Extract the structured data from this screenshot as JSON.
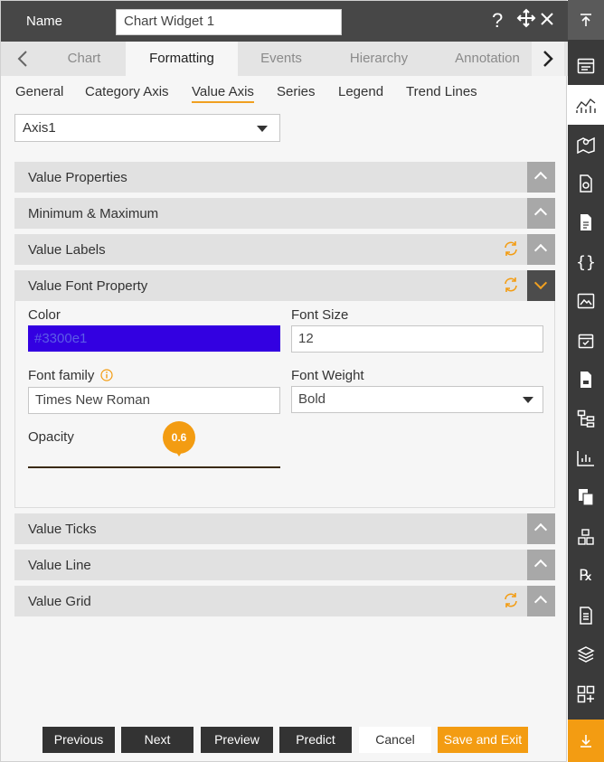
{
  "header": {
    "name_label": "Name",
    "widget_name": "Chart Widget 1",
    "help_icon": "question-mark",
    "move_icon": "move-arrows",
    "close_icon": "close-x"
  },
  "tabs": [
    "Chart",
    "Formatting",
    "Events",
    "Hierarchy",
    "Annotation"
  ],
  "active_tab": "Formatting",
  "subtabs": [
    "General",
    "Category Axis",
    "Value Axis",
    "Series",
    "Legend",
    "Trend Lines"
  ],
  "active_subtab": "Value Axis",
  "axis_select": {
    "value": "Axis1"
  },
  "sections": {
    "value_properties": "Value Properties",
    "min_max": "Minimum & Maximum",
    "value_labels": "Value Labels",
    "value_font_property": "Value Font Property",
    "value_ticks": "Value Ticks",
    "value_line": "Value Line",
    "value_grid": "Value Grid"
  },
  "font_property": {
    "color_label": "Color",
    "color_value": "#3300e1",
    "font_size_label": "Font Size",
    "font_size_value": "12",
    "font_family_label": "Font family",
    "font_family_value": "Times New Roman",
    "font_weight_label": "Font Weight",
    "font_weight_value": "Bold",
    "opacity_label": "Opacity",
    "opacity_value": "0.6"
  },
  "footer": {
    "previous": "Previous",
    "next": "Next",
    "preview": "Preview",
    "predict": "Predict",
    "cancel": "Cancel",
    "save_exit": "Save and Exit"
  },
  "colors": {
    "accent": "#f39c12",
    "header_bg": "#474747",
    "sidebar_bg": "#3a3a3a",
    "color_swatch": "#3300e1"
  },
  "sidebar_icons": [
    "scroll-top-icon",
    "widget-icon",
    "chart-icon",
    "map-icon",
    "report-icon",
    "document-icon",
    "code-icon",
    "image-icon",
    "calendar-icon",
    "file-icon",
    "hierarchy-icon",
    "bar-chart-icon",
    "copy-icon",
    "cubes-icon",
    "rx-icon",
    "doc-list-icon",
    "layers-icon",
    "add-widget-icon",
    "scroll-bottom-icon"
  ]
}
